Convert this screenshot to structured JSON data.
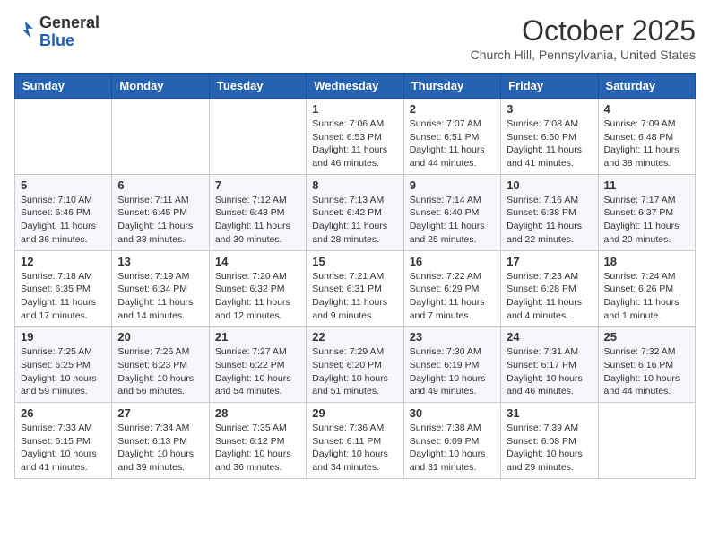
{
  "header": {
    "logo_general": "General",
    "logo_blue": "Blue",
    "month_title": "October 2025",
    "location": "Church Hill, Pennsylvania, United States"
  },
  "weekdays": [
    "Sunday",
    "Monday",
    "Tuesday",
    "Wednesday",
    "Thursday",
    "Friday",
    "Saturday"
  ],
  "weeks": [
    [
      null,
      null,
      null,
      {
        "day": 1,
        "sunrise": "7:06 AM",
        "sunset": "6:53 PM",
        "daylight": "11 hours and 46 minutes."
      },
      {
        "day": 2,
        "sunrise": "7:07 AM",
        "sunset": "6:51 PM",
        "daylight": "11 hours and 44 minutes."
      },
      {
        "day": 3,
        "sunrise": "7:08 AM",
        "sunset": "6:50 PM",
        "daylight": "11 hours and 41 minutes."
      },
      {
        "day": 4,
        "sunrise": "7:09 AM",
        "sunset": "6:48 PM",
        "daylight": "11 hours and 38 minutes."
      }
    ],
    [
      {
        "day": 5,
        "sunrise": "7:10 AM",
        "sunset": "6:46 PM",
        "daylight": "11 hours and 36 minutes."
      },
      {
        "day": 6,
        "sunrise": "7:11 AM",
        "sunset": "6:45 PM",
        "daylight": "11 hours and 33 minutes."
      },
      {
        "day": 7,
        "sunrise": "7:12 AM",
        "sunset": "6:43 PM",
        "daylight": "11 hours and 30 minutes."
      },
      {
        "day": 8,
        "sunrise": "7:13 AM",
        "sunset": "6:42 PM",
        "daylight": "11 hours and 28 minutes."
      },
      {
        "day": 9,
        "sunrise": "7:14 AM",
        "sunset": "6:40 PM",
        "daylight": "11 hours and 25 minutes."
      },
      {
        "day": 10,
        "sunrise": "7:16 AM",
        "sunset": "6:38 PM",
        "daylight": "11 hours and 22 minutes."
      },
      {
        "day": 11,
        "sunrise": "7:17 AM",
        "sunset": "6:37 PM",
        "daylight": "11 hours and 20 minutes."
      }
    ],
    [
      {
        "day": 12,
        "sunrise": "7:18 AM",
        "sunset": "6:35 PM",
        "daylight": "11 hours and 17 minutes."
      },
      {
        "day": 13,
        "sunrise": "7:19 AM",
        "sunset": "6:34 PM",
        "daylight": "11 hours and 14 minutes."
      },
      {
        "day": 14,
        "sunrise": "7:20 AM",
        "sunset": "6:32 PM",
        "daylight": "11 hours and 12 minutes."
      },
      {
        "day": 15,
        "sunrise": "7:21 AM",
        "sunset": "6:31 PM",
        "daylight": "11 hours and 9 minutes."
      },
      {
        "day": 16,
        "sunrise": "7:22 AM",
        "sunset": "6:29 PM",
        "daylight": "11 hours and 7 minutes."
      },
      {
        "day": 17,
        "sunrise": "7:23 AM",
        "sunset": "6:28 PM",
        "daylight": "11 hours and 4 minutes."
      },
      {
        "day": 18,
        "sunrise": "7:24 AM",
        "sunset": "6:26 PM",
        "daylight": "11 hours and 1 minute."
      }
    ],
    [
      {
        "day": 19,
        "sunrise": "7:25 AM",
        "sunset": "6:25 PM",
        "daylight": "10 hours and 59 minutes."
      },
      {
        "day": 20,
        "sunrise": "7:26 AM",
        "sunset": "6:23 PM",
        "daylight": "10 hours and 56 minutes."
      },
      {
        "day": 21,
        "sunrise": "7:27 AM",
        "sunset": "6:22 PM",
        "daylight": "10 hours and 54 minutes."
      },
      {
        "day": 22,
        "sunrise": "7:29 AM",
        "sunset": "6:20 PM",
        "daylight": "10 hours and 51 minutes."
      },
      {
        "day": 23,
        "sunrise": "7:30 AM",
        "sunset": "6:19 PM",
        "daylight": "10 hours and 49 minutes."
      },
      {
        "day": 24,
        "sunrise": "7:31 AM",
        "sunset": "6:17 PM",
        "daylight": "10 hours and 46 minutes."
      },
      {
        "day": 25,
        "sunrise": "7:32 AM",
        "sunset": "6:16 PM",
        "daylight": "10 hours and 44 minutes."
      }
    ],
    [
      {
        "day": 26,
        "sunrise": "7:33 AM",
        "sunset": "6:15 PM",
        "daylight": "10 hours and 41 minutes."
      },
      {
        "day": 27,
        "sunrise": "7:34 AM",
        "sunset": "6:13 PM",
        "daylight": "10 hours and 39 minutes."
      },
      {
        "day": 28,
        "sunrise": "7:35 AM",
        "sunset": "6:12 PM",
        "daylight": "10 hours and 36 minutes."
      },
      {
        "day": 29,
        "sunrise": "7:36 AM",
        "sunset": "6:11 PM",
        "daylight": "10 hours and 34 minutes."
      },
      {
        "day": 30,
        "sunrise": "7:38 AM",
        "sunset": "6:09 PM",
        "daylight": "10 hours and 31 minutes."
      },
      {
        "day": 31,
        "sunrise": "7:39 AM",
        "sunset": "6:08 PM",
        "daylight": "10 hours and 29 minutes."
      },
      null
    ]
  ]
}
